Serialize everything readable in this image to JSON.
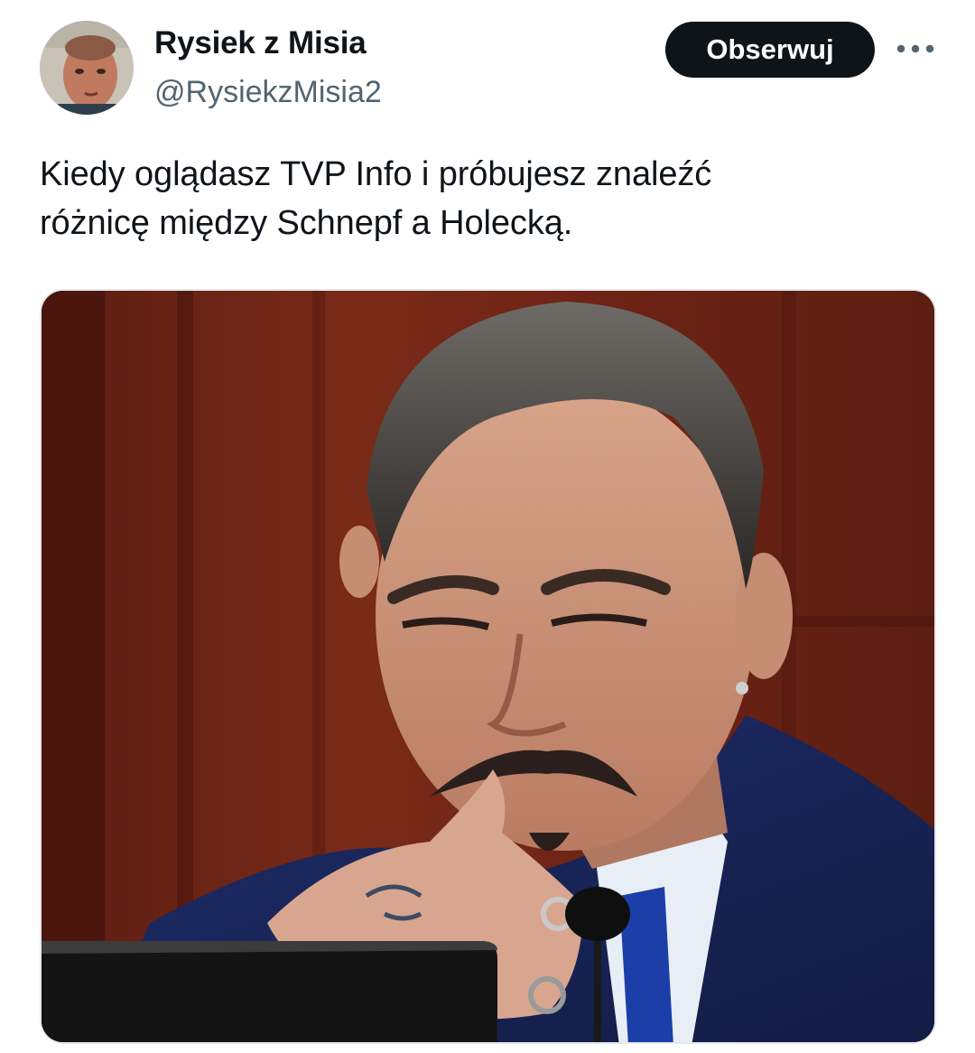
{
  "author": {
    "display_name": "Rysiek z Misia",
    "handle": "@RysiekzMisia2",
    "avatar_icon": "user-avatar-photo"
  },
  "actions": {
    "follow_label": "Obserwuj",
    "more_icon": "more-horizontal-icon"
  },
  "tweet": {
    "text_lines": [
      "Kiedy oglądasz TVP Info i próbujesz znaleźć",
      "różnicę między Schnepf a Holecką."
    ]
  },
  "media": {
    "type": "photo",
    "icon": "tweet-photo"
  },
  "colors": {
    "text": "#0f1419",
    "secondary": "#536471",
    "button_bg": "#0f1419",
    "button_text": "#ffffff",
    "border": "#e6e9ec"
  }
}
